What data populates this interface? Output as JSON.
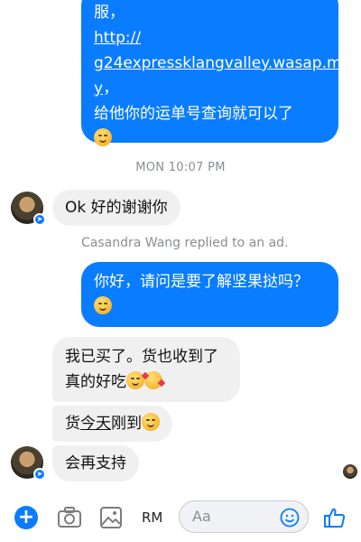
{
  "messages": {
    "top_outgoing": {
      "line1": "服，",
      "link_line1": "http://",
      "link_line2": "g24expressklangvalley.wasap.m",
      "link_line3": "y",
      "line_after": "，",
      "line_last": "给他你的运单号查询就可以了",
      "emoji": "smiling-face"
    },
    "timestamp": "MON 10:07 PM",
    "incoming_1": "Ok 好的谢谢你",
    "replied_note": "Casandra Wang replied to an ad.",
    "outgoing_2": {
      "line1": "你好，请问是要了解坚果挞吗？",
      "emoji": "grinning-face"
    },
    "incoming_2": {
      "line1": "我已买了。货也收到了",
      "line2": "真的好吃"
    },
    "incoming_3": {
      "prefix": "货",
      "underlined": "今天",
      "suffix": "刚到"
    },
    "incoming_4": "会再支持"
  },
  "composer": {
    "rm_label": "RM",
    "placeholder": "Aa"
  },
  "colors": {
    "outgoing_bubble": "#0a7cff",
    "incoming_bubble": "#f0f0f0",
    "meta_text": "#8a8d91",
    "accent": "#0a7cff"
  },
  "icons": [
    "plus-icon",
    "camera-icon",
    "gallery-icon",
    "emoji-icon",
    "thumbs-up-icon",
    "messenger-badge-icon"
  ]
}
